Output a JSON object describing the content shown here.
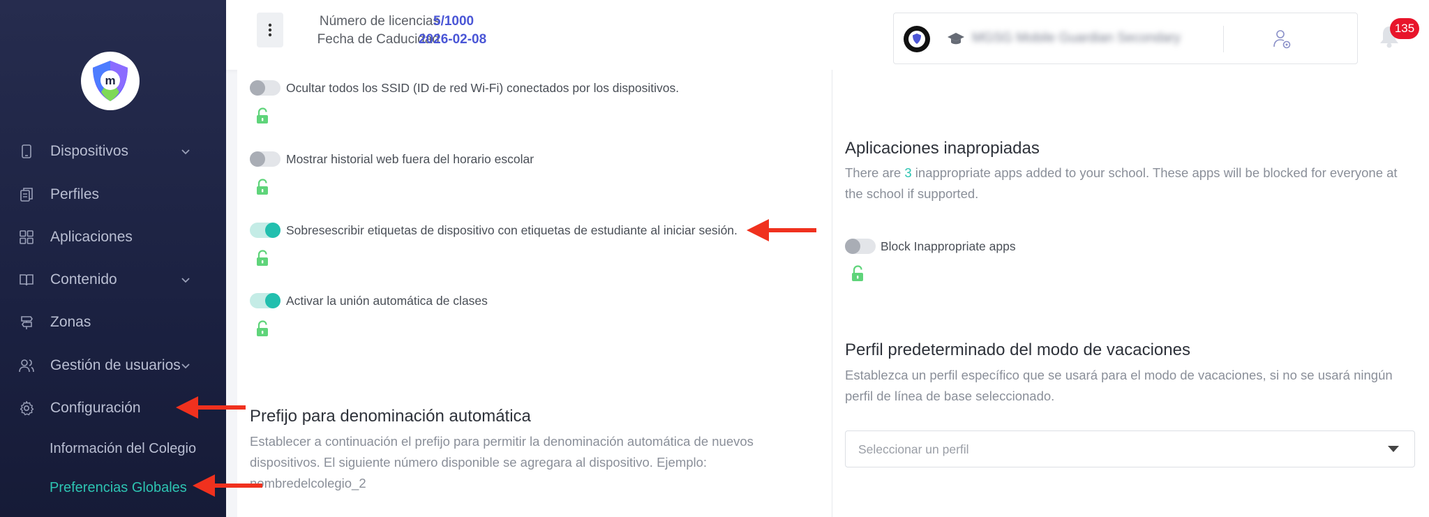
{
  "sidebar": {
    "items": [
      {
        "label": "Dispositivos",
        "icon": "tablet-icon",
        "has_chevron": true
      },
      {
        "label": "Perfiles",
        "icon": "profiles-icon",
        "has_chevron": false
      },
      {
        "label": "Aplicaciones",
        "icon": "apps-grid-icon",
        "has_chevron": false
      },
      {
        "label": "Contenido",
        "icon": "book-icon",
        "has_chevron": true
      },
      {
        "label": "Zonas",
        "icon": "signpost-icon",
        "has_chevron": false
      },
      {
        "label": "Gestión de usuarios",
        "icon": "users-icon",
        "has_chevron": true
      },
      {
        "label": "Configuración",
        "icon": "gear-icon",
        "has_chevron": false
      }
    ],
    "sub_items": [
      {
        "label": "Información del Colegio",
        "active": false
      },
      {
        "label": "Preferencias Globales",
        "active": true
      }
    ]
  },
  "header": {
    "licenses_label": "Número de licencias",
    "licenses_value": "5/1000",
    "expiry_label": "Fecha de Caducidad",
    "expiry_value": "2026-02-08",
    "school_name": "MGSG Mobile Guardian Secondary",
    "notification_count": "135"
  },
  "left_panel": {
    "toggles": [
      {
        "label": "Ocultar todos los SSID (ID de red Wi-Fi) conectados por los dispositivos.",
        "on": false
      },
      {
        "label": "Mostrar historial web fuera del horario escolar",
        "on": false
      },
      {
        "label": "Sobresescribir etiquetas de dispositivo con etiquetas de estudiante al iniciar sesión.",
        "on": true
      },
      {
        "label": "Activar la unión automática de clases",
        "on": true
      }
    ],
    "prefix_section": {
      "title": "Prefijo para denominación automática",
      "description": "Establecer a continuación el prefijo para permitir la denominación automática de nuevos dispositivos. El siguiente número disponible se agregara al dispositivo. Ejemplo: nombredelcolegio_2"
    }
  },
  "right_panel": {
    "inappropriate": {
      "title": "Aplicaciones inapropiadas",
      "desc_before": "There are ",
      "count": "3",
      "desc_after": " inappropriate apps added to your school. These apps will be blocked for everyone at the school if supported.",
      "toggle_label": "Block Inappropriate apps",
      "toggle_on": false
    },
    "vacation": {
      "title": "Perfil predeterminado del modo de vacaciones",
      "description": "Establezca un perfil específico que se usará para el modo de vacaciones, si no se usará ningún perfil de línea de base seleccionado.",
      "select_placeholder": "Seleccionar un perfil"
    }
  },
  "colors": {
    "accent": "#2dc4b2",
    "link_value": "#4a56d6",
    "badge": "#e8142a",
    "arrow": "#f0311e",
    "lock": "#5fd47a"
  }
}
